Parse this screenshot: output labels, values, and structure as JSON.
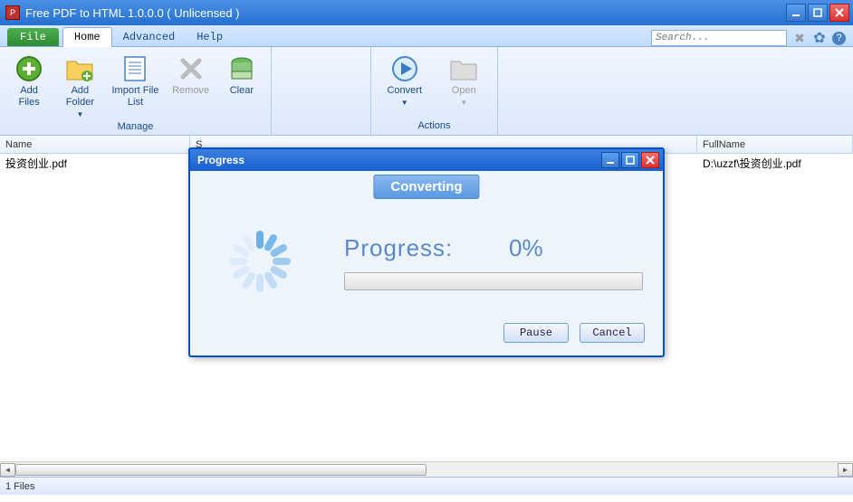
{
  "window": {
    "title": "Free PDF to HTML 1.0.0.0  ( Unlicensed )"
  },
  "menu": {
    "file": "File",
    "tabs": [
      "Home",
      "Advanced",
      "Help"
    ],
    "active_tab": "Home",
    "search_placeholder": "Search..."
  },
  "ribbon": {
    "manage": {
      "label": "Manage",
      "add_files": "Add\nFiles",
      "add_folder": "Add\nFolder",
      "import_list": "Import File\nList",
      "remove": "Remove",
      "clear": "Clear"
    },
    "actions": {
      "label": "Actions",
      "convert": "Convert",
      "open": "Open"
    }
  },
  "table": {
    "columns": {
      "name": "Name",
      "fullname": "FullName",
      "s": "S"
    },
    "rows": [
      {
        "name": "投资创业.pdf",
        "fullname": "D:\\uzzf\\投资创业.pdf"
      }
    ]
  },
  "status": {
    "text": "1 Files"
  },
  "dialog": {
    "title": "Progress",
    "banner": "Converting",
    "label": "Progress:",
    "value": "0%",
    "pause": "Pause",
    "cancel": "Cancel"
  }
}
